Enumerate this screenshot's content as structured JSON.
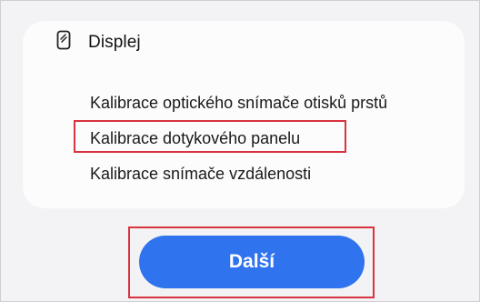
{
  "section": {
    "icon": "phone-icon",
    "title": "Displej",
    "items": [
      {
        "label": "Kalibrace optického snímače otisků prstů"
      },
      {
        "label": "Kalibrace dotykového panelu"
      },
      {
        "label": "Kalibrace snímače vzdálenosti"
      }
    ]
  },
  "button": {
    "label": "Další"
  },
  "colors": {
    "accent": "#2f73ee",
    "highlight": "#d9333f"
  }
}
